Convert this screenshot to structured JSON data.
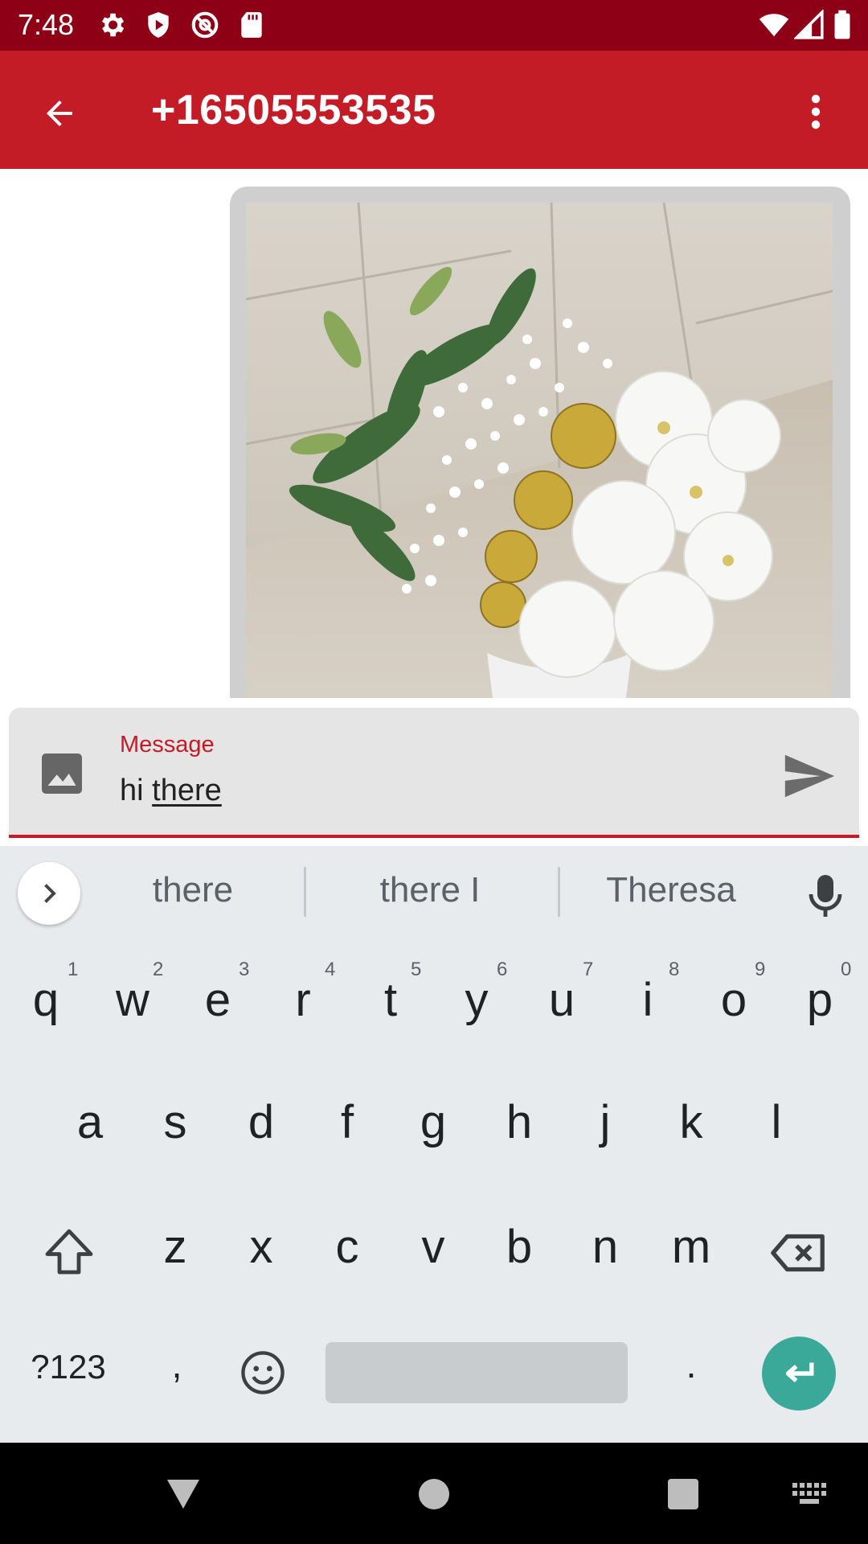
{
  "status_bar": {
    "time": "7:48",
    "left_icons": [
      "settings-icon",
      "shield-play-icon",
      "at-sign-icon",
      "sd-card-icon"
    ],
    "right_icons": [
      "wifi-icon",
      "signal-icon",
      "battery-icon"
    ]
  },
  "app_bar": {
    "title": "+16505553535",
    "color": "#c41c27",
    "status_color": "#8e0016"
  },
  "conversation": {
    "attachment": "flower bouquet photo"
  },
  "compose": {
    "label": "Message",
    "value_plain": "hi ",
    "value_underlined": "there"
  },
  "keyboard": {
    "suggestions": [
      "there",
      "there I",
      "Theresa"
    ],
    "row1": [
      "q",
      "w",
      "e",
      "r",
      "t",
      "y",
      "u",
      "i",
      "o",
      "p"
    ],
    "row1_hints": [
      "1",
      "2",
      "3",
      "4",
      "5",
      "6",
      "7",
      "8",
      "9",
      "0"
    ],
    "row2": [
      "a",
      "s",
      "d",
      "f",
      "g",
      "h",
      "j",
      "k",
      "l"
    ],
    "row3": [
      "z",
      "x",
      "c",
      "v",
      "b",
      "n",
      "m"
    ],
    "symbols_label": "?123",
    "comma": ",",
    "period": ".",
    "enter_color": "#3aa99a"
  }
}
